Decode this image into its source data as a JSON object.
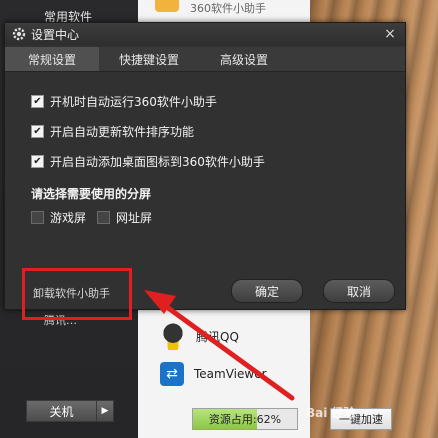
{
  "background_sidebar": {
    "category_label": "常用软件",
    "sub_label": "腾讯…",
    "power_button_label": "关机",
    "power_arrow": "▶"
  },
  "launcher": {
    "top_app_text": "360软件小助手",
    "apps": [
      {
        "name": "腾讯QQ",
        "icon": "qq-icon"
      },
      {
        "name": "TeamViewer",
        "icon": "teamviewer-icon"
      }
    ],
    "resource_label": "资源占用:62%",
    "resource_percent": 62,
    "speedup_label": "一键加速",
    "watermark": "Bai 经验"
  },
  "dialog": {
    "title": "设置中心",
    "close_glyph": "×",
    "tabs": [
      {
        "label": "常规设置",
        "active": true
      },
      {
        "label": "快捷键设置",
        "active": false
      },
      {
        "label": "高级设置",
        "active": false
      }
    ],
    "options": [
      {
        "label": "开机时自动运行360软件小助手",
        "checked": true
      },
      {
        "label": "开启自动更新软件排序功能",
        "checked": true
      },
      {
        "label": "开启自动添加桌面图标到360软件小助手",
        "checked": true
      }
    ],
    "screen_section_title": "请选择需要使用的分屏",
    "screen_options": [
      {
        "label": "游戏屏",
        "checked": false
      },
      {
        "label": "网址屏",
        "checked": false
      }
    ],
    "uninstall_label": "卸载软件小助手",
    "ok_label": "确定",
    "cancel_label": "取消"
  },
  "colors": {
    "annotation_red": "#e02020",
    "dialog_bg": "#313131",
    "resource_fill": "#8cc74a"
  }
}
